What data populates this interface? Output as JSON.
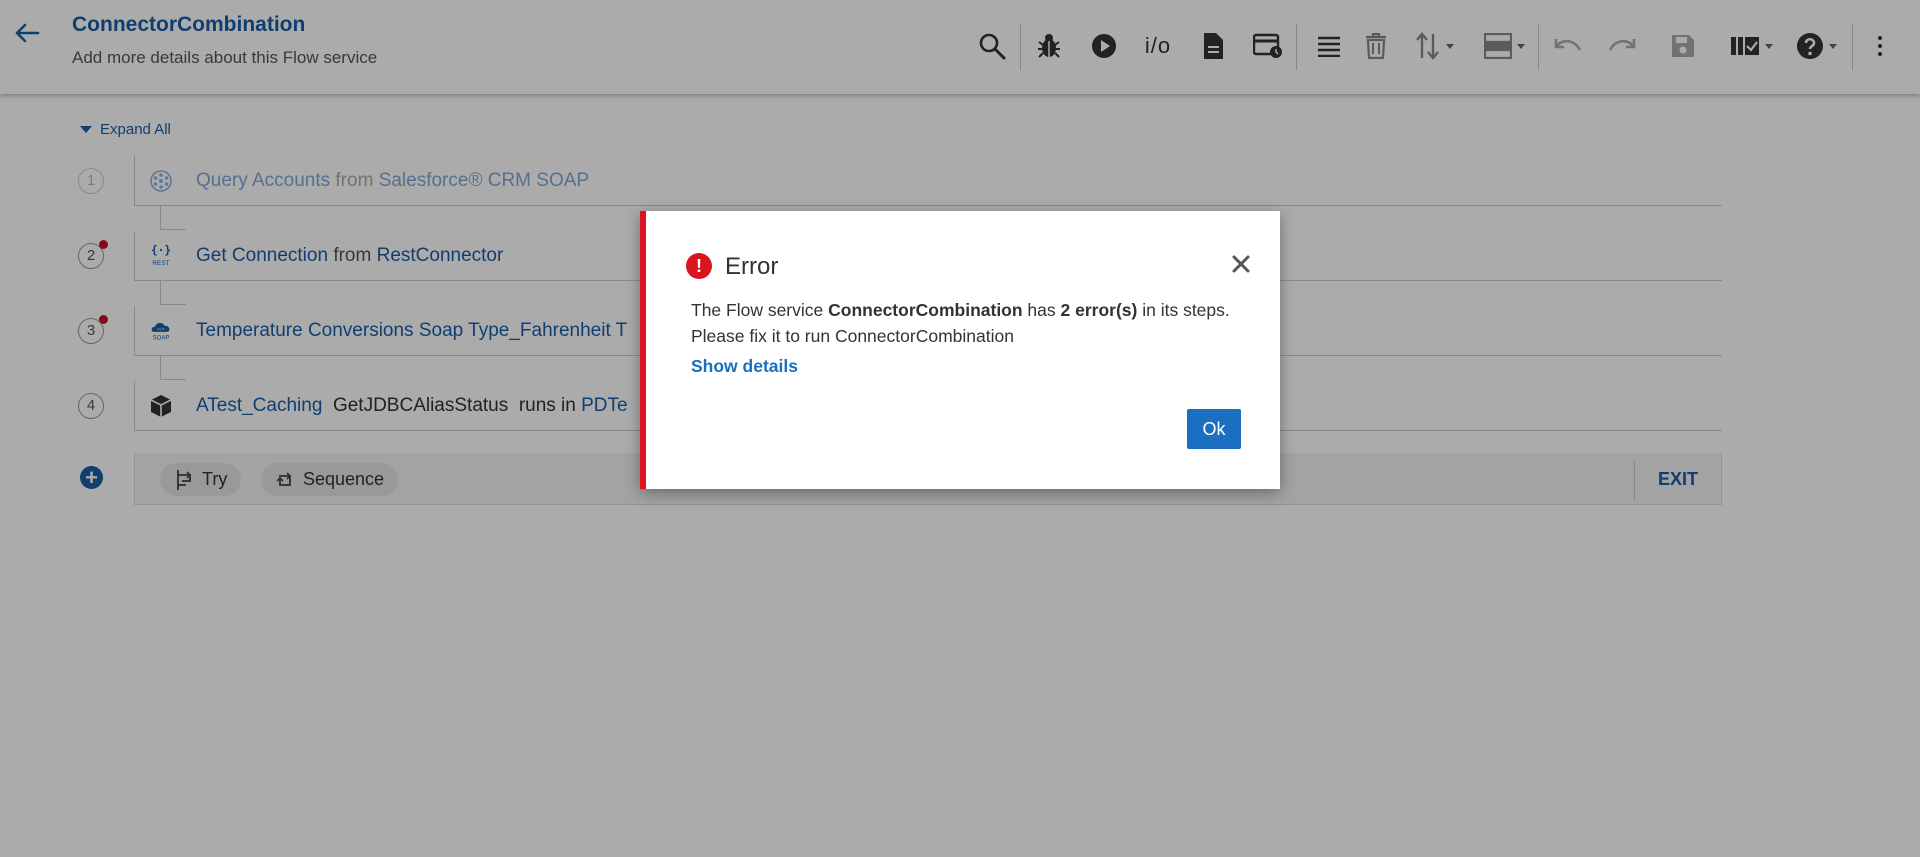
{
  "header": {
    "title": "ConnectorCombination",
    "subtitle": "Add more details about this Flow service",
    "io_label": "i/o"
  },
  "canvas": {
    "expand_all": "Expand All",
    "steps": [
      {
        "number": "1",
        "name": "Query Accounts",
        "connector_word": "from",
        "source": "Salesforce® CRM SOAP",
        "has_error": false,
        "disabled": true
      },
      {
        "number": "2",
        "name": "Get Connection",
        "connector_word": "from",
        "source": "RestConnector",
        "icon_label": "REST",
        "has_error": true,
        "disabled": false
      },
      {
        "number": "3",
        "name": "Temperature Conversions Soap Type_Fahrenheit T",
        "icon_label": "SOAP",
        "has_error": true,
        "disabled": false
      },
      {
        "number": "4",
        "name": "ATest_Caching",
        "operation": "GetJDBCAliasStatus",
        "connector_word": "runs in",
        "source": "PDTe",
        "has_error": false,
        "disabled": false
      }
    ],
    "chips": {
      "try": "Try",
      "sequence": "Sequence"
    },
    "exit": "EXIT"
  },
  "dialog": {
    "title": "Error",
    "msg_prefix": "The Flow service ",
    "service_name": "ConnectorCombination",
    "msg_mid": " has ",
    "error_count": "2 error(s)",
    "msg_suffix": " in its steps.",
    "msg_line2": "Please fix it to run ConnectorCombination",
    "details_link": "Show details",
    "ok_label": "Ok"
  },
  "colors": {
    "brand_blue": "#1a5da8",
    "error_red": "#d9161f",
    "button_blue": "#1a6fc0"
  }
}
